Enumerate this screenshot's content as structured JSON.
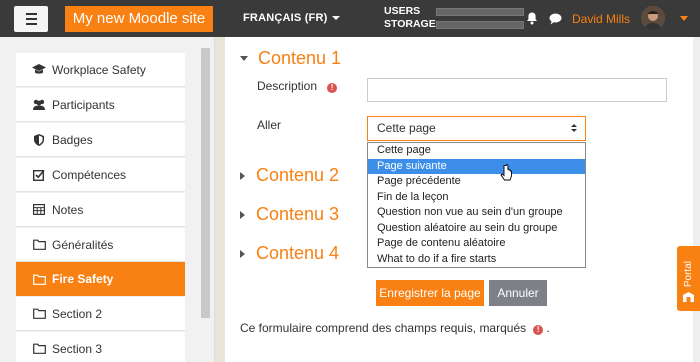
{
  "navbar": {
    "site_name": "My new Moodle site",
    "language": "FRANÇAIS (FR)",
    "users_label": "USERS",
    "storage_label": "STORAGE",
    "user_name": "David Mills"
  },
  "sidebar": {
    "items": [
      {
        "label": "Workplace Safety",
        "icon": "graduation-cap-icon"
      },
      {
        "label": "Participants",
        "icon": "users-icon"
      },
      {
        "label": "Badges",
        "icon": "shield-icon"
      },
      {
        "label": "Compétences",
        "icon": "checkbox-icon"
      },
      {
        "label": "Notes",
        "icon": "table-icon"
      },
      {
        "label": "Généralités",
        "icon": "folder-icon"
      },
      {
        "label": "Fire Safety",
        "icon": "folder-icon",
        "active": true
      },
      {
        "label": "Section 2",
        "icon": "folder-icon"
      },
      {
        "label": "Section 3",
        "icon": "folder-icon"
      }
    ]
  },
  "form": {
    "section1_title": "Contenu 1",
    "description_label": "Description",
    "description_value": "",
    "goto_label": "Aller",
    "select_value": "Cette page",
    "options": [
      "Cette page",
      "Page suivante",
      "Page précédente",
      "Fin de la leçon",
      "Question non vue au sein d'un groupe",
      "Question aléatoire au sein du groupe",
      "Page de contenu aléatoire",
      "What to do if a fire starts"
    ],
    "highlighted_option": "Page suivante",
    "section2_title": "Contenu 2",
    "section3_title": "Contenu 3",
    "section4_title": "Contenu 4",
    "save_label": "Enregistrer la page",
    "cancel_label": "Annuler",
    "required_note": "Ce formulaire comprend des champs requis, marqués",
    "required_note_end": "."
  },
  "portal": {
    "label": "Portal"
  },
  "colors": {
    "accent": "#f98012",
    "navbar": "#3a3a3a",
    "highlight": "#3d8ee9",
    "required": "#d9534f"
  }
}
